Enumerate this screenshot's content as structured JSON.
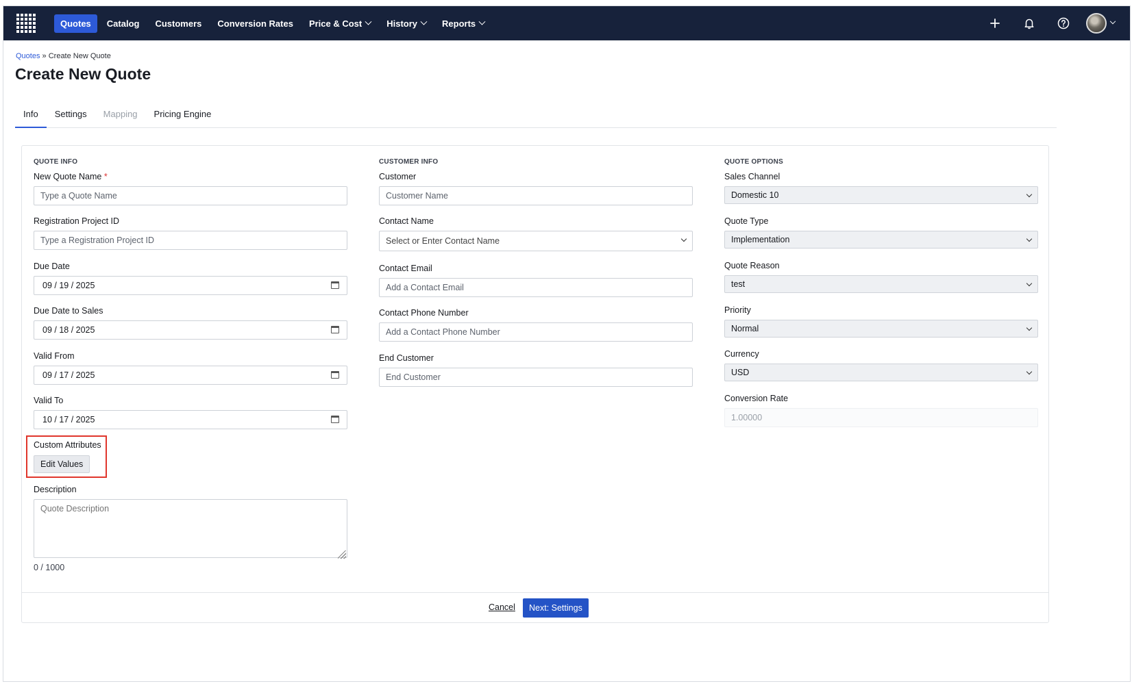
{
  "nav": {
    "items": [
      {
        "label": "Quotes",
        "active": true,
        "dropdown": false
      },
      {
        "label": "Catalog",
        "active": false,
        "dropdown": false
      },
      {
        "label": "Customers",
        "active": false,
        "dropdown": false
      },
      {
        "label": "Conversion Rates",
        "active": false,
        "dropdown": false
      },
      {
        "label": "Price & Cost",
        "active": false,
        "dropdown": true
      },
      {
        "label": "History",
        "active": false,
        "dropdown": true
      },
      {
        "label": "Reports",
        "active": false,
        "dropdown": true
      }
    ],
    "icons": [
      "app-grid-icon",
      "plus-icon",
      "bell-icon",
      "help-icon",
      "avatar"
    ],
    "colors": {
      "bar": "#17223b",
      "active": "#2d5ad8"
    }
  },
  "breadcrumb": {
    "root": "Quotes",
    "separator": "»",
    "current": "Create New Quote"
  },
  "page": {
    "title": "Create New Quote"
  },
  "tabs": [
    {
      "label": "Info",
      "state": "active"
    },
    {
      "label": "Settings",
      "state": "normal"
    },
    {
      "label": "Mapping",
      "state": "disabled"
    },
    {
      "label": "Pricing Engine",
      "state": "normal"
    }
  ],
  "quote_info": {
    "title": "QUOTE INFO",
    "quote_name": {
      "label": "New Quote Name",
      "required": "*",
      "placeholder": "Type a Quote Name"
    },
    "registration_id": {
      "label": "Registration Project ID",
      "placeholder": "Type a Registration Project ID"
    },
    "due_date": {
      "label": "Due Date",
      "value": "09 / 19 / 2025"
    },
    "due_date_sales": {
      "label": "Due Date to Sales",
      "value": "09 / 18 / 2025"
    },
    "valid_from": {
      "label": "Valid From",
      "value": "09 / 17 / 2025"
    },
    "valid_to": {
      "label": "Valid To",
      "value": "10 / 17 / 2025"
    },
    "custom_attributes": {
      "label": "Custom Attributes",
      "button": "Edit Values"
    },
    "description": {
      "label": "Description",
      "placeholder": "Quote Description",
      "counter": "0 / 1000"
    }
  },
  "customer_info": {
    "title": "CUSTOMER INFO",
    "customer": {
      "label": "Customer",
      "placeholder": "Customer Name"
    },
    "contact_name": {
      "label": "Contact Name",
      "placeholder": "Select or Enter Contact Name"
    },
    "contact_email": {
      "label": "Contact Email",
      "placeholder": "Add a Contact Email"
    },
    "contact_phone": {
      "label": "Contact Phone Number",
      "placeholder": "Add a Contact Phone Number"
    },
    "end_customer": {
      "label": "End Customer",
      "placeholder": "End Customer"
    }
  },
  "quote_options": {
    "title": "QUOTE OPTIONS",
    "sales_channel": {
      "label": "Sales Channel",
      "value": "Domestic 10"
    },
    "quote_type": {
      "label": "Quote Type",
      "value": "Implementation"
    },
    "quote_reason": {
      "label": "Quote Reason",
      "value": "test"
    },
    "priority": {
      "label": "Priority",
      "value": "Normal"
    },
    "currency": {
      "label": "Currency",
      "value": "USD"
    },
    "conversion_rate": {
      "label": "Conversion Rate",
      "value": "1.00000"
    }
  },
  "footer": {
    "cancel": "Cancel",
    "next": "Next: Settings"
  }
}
